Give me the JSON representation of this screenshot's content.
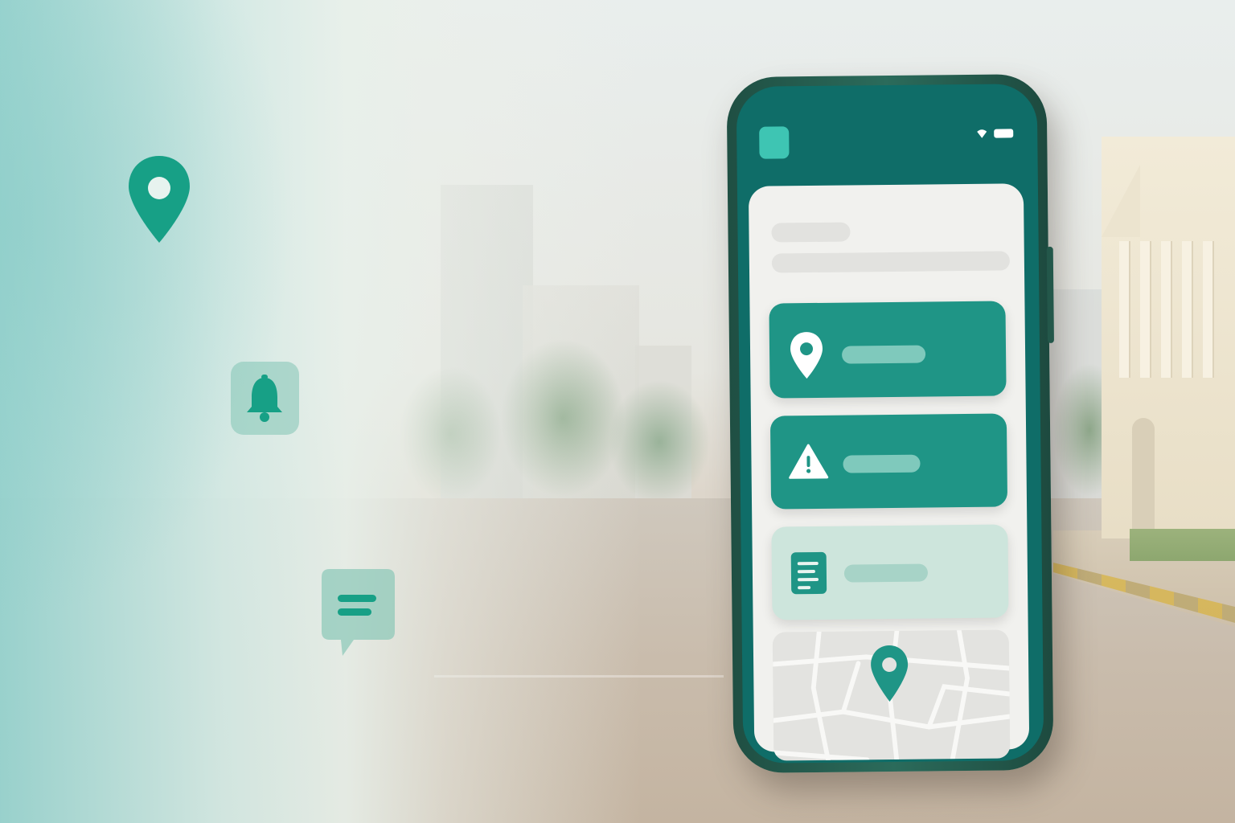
{
  "app": {
    "logo_icon": "app-logo-square",
    "status_icons": [
      "wifi-icon",
      "battery-icon"
    ]
  },
  "floating_icons": [
    "map-pin-icon",
    "bell-icon",
    "chat-bubble-icon"
  ],
  "cards": [
    {
      "id": "location",
      "icon": "map-pin-icon",
      "style": "dark"
    },
    {
      "id": "alert",
      "icon": "warning-icon",
      "style": "dark"
    },
    {
      "id": "report",
      "icon": "document-icon",
      "style": "light"
    }
  ],
  "map": {
    "marker_icon": "map-pin-icon"
  },
  "colors": {
    "brand_primary": "#1f9586",
    "brand_dark": "#0f6d68",
    "phone_frame": "#2b6b5b",
    "accent_teal": "#3ec5b3",
    "card_light": "#cde5dc",
    "pill": "#7fc9bc"
  }
}
